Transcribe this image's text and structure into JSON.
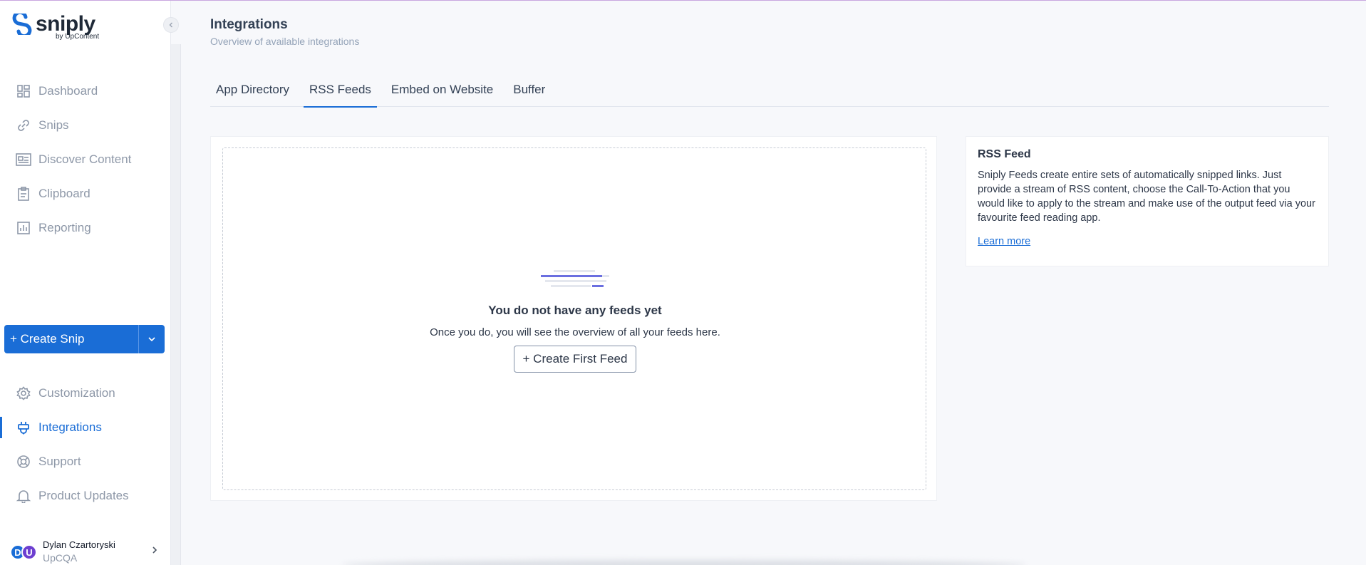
{
  "app": {
    "logo_word": "sniply",
    "logo_sub": "by UpContent",
    "brand_color": "#1a6dd6"
  },
  "sidebar": {
    "primary_items": [
      {
        "label": "Dashboard",
        "icon": "dashboard-icon"
      },
      {
        "label": "Snips",
        "icon": "snips-icon"
      },
      {
        "label": "Discover Content",
        "icon": "discover-icon"
      },
      {
        "label": "Clipboard",
        "icon": "clipboard-icon"
      },
      {
        "label": "Reporting",
        "icon": "reporting-icon"
      }
    ],
    "create_label": "+ Create Snip",
    "secondary_items": [
      {
        "label": "Customization",
        "icon": "gear-icon"
      },
      {
        "label": "Integrations",
        "icon": "plug-icon",
        "active": true
      },
      {
        "label": "Support",
        "icon": "lifebuoy-icon"
      },
      {
        "label": "Product Updates",
        "icon": "bell-icon"
      }
    ],
    "user": {
      "name": "Dylan Czartoryski",
      "org": "UpCQA",
      "avatar1": "D",
      "avatar2": "U"
    }
  },
  "header": {
    "title": "Integrations",
    "subtitle": "Overview of available integrations"
  },
  "tabs": [
    {
      "label": "App Directory"
    },
    {
      "label": "RSS Feeds",
      "active": true
    },
    {
      "label": "Embed on Website"
    },
    {
      "label": "Buffer"
    }
  ],
  "empty_state": {
    "title": "You do not have any feeds yet",
    "text": "Once you do, you will see the overview of all your feeds here.",
    "button": "+ Create First Feed"
  },
  "info_card": {
    "title": "RSS Feed",
    "text": "Sniply Feeds create entire sets of automatically snipped links. Just provide a stream of RSS content, choose the Call-To-Action that you would like to apply to the stream and make use of the output feed via your favourite feed reading app.",
    "link": "Learn more"
  }
}
